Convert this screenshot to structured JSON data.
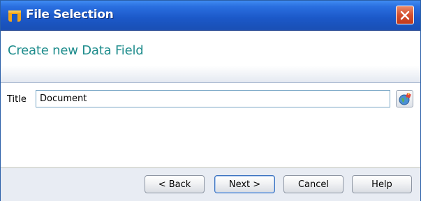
{
  "window": {
    "title": "File Selection"
  },
  "header": {
    "title": "Create new Data Field"
  },
  "form": {
    "title_label": "Title",
    "title_value": "Document"
  },
  "footer": {
    "back_label": "< Back",
    "next_label": "Next >",
    "cancel_label": "Cancel",
    "help_label": "Help"
  },
  "icons": {
    "app": "app-logo-icon",
    "close": "close-icon",
    "picker": "globe-picker-icon"
  },
  "colors": {
    "titlebar": "#1b58c8",
    "header_title": "#1e8c8c",
    "close_button": "#d4502e",
    "input_border": "#7aa7c6"
  }
}
